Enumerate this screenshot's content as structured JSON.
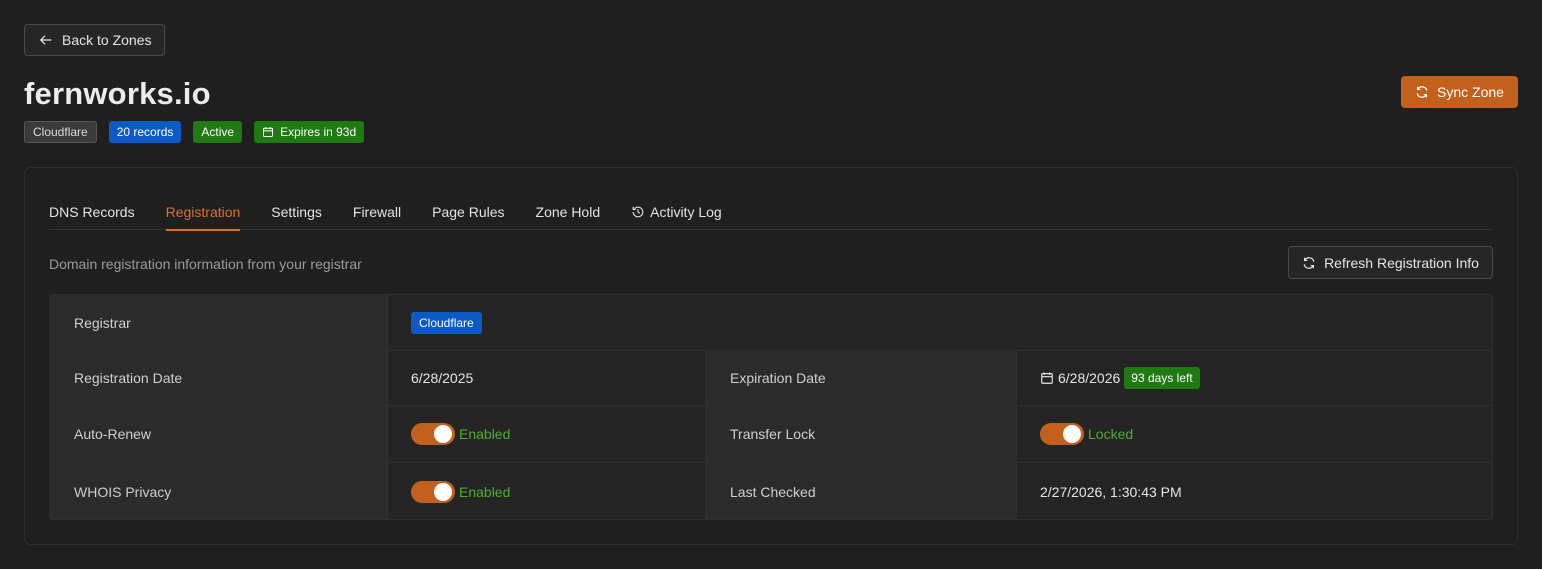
{
  "back_label": "Back to Zones",
  "zone": {
    "title": "fernworks.io",
    "tags": {
      "provider": "Cloudflare",
      "records": "20 records",
      "status": "Active",
      "expires": "Expires in 93d"
    },
    "sync_label": "Sync Zone"
  },
  "tabs": [
    {
      "label": "DNS Records"
    },
    {
      "label": "Registration"
    },
    {
      "label": "Settings"
    },
    {
      "label": "Firewall"
    },
    {
      "label": "Page Rules"
    },
    {
      "label": "Zone Hold"
    },
    {
      "label": "Activity Log"
    }
  ],
  "active_tab": "Registration",
  "registration": {
    "description": "Domain registration information from your registrar",
    "refresh_label": "Refresh Registration Info",
    "registrar_label": "Registrar",
    "registrar_value": "Cloudflare",
    "reg_date_label": "Registration Date",
    "reg_date_value": "6/28/2025",
    "exp_date_label": "Expiration Date",
    "exp_date_value": "6/28/2026",
    "days_left": "93 days left",
    "auto_renew_label": "Auto-Renew",
    "auto_renew_value": "Enabled",
    "transfer_lock_label": "Transfer Lock",
    "transfer_lock_value": "Locked",
    "whois_label": "WHOIS Privacy",
    "whois_value": "Enabled",
    "last_checked_label": "Last Checked",
    "last_checked_value": "2/27/2026, 1:30:43 PM"
  },
  "colors": {
    "accent": "#c4601e",
    "blue_badge": "#0c5bc4",
    "green_badge": "#1f7a12",
    "enabled_text": "#4caf2a"
  }
}
